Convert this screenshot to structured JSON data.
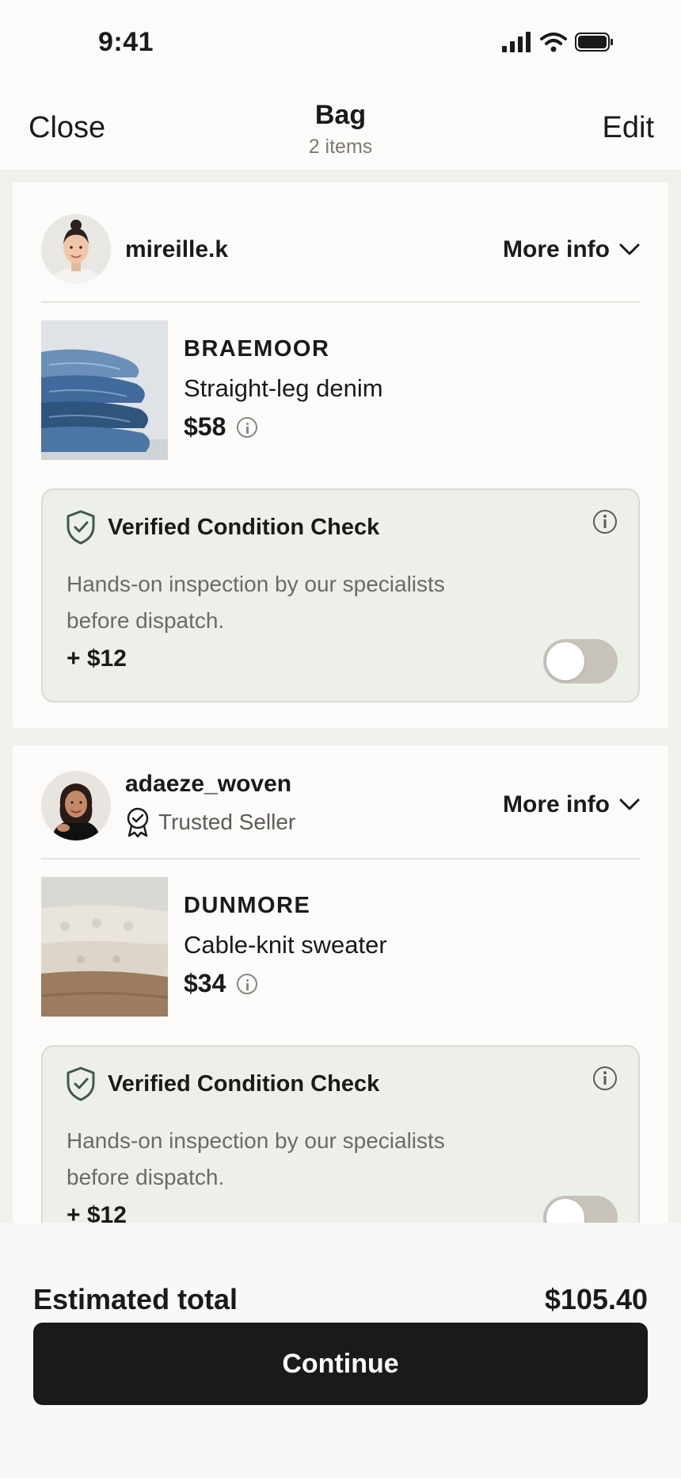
{
  "status_bar": {
    "time": "9:41"
  },
  "nav": {
    "close_label": "Close",
    "title": "Bag",
    "subtitle": "2 items",
    "edit_label": "Edit"
  },
  "sellers": [
    {
      "name": "mireille.k",
      "badge": "",
      "more_info_label": "More info",
      "item": {
        "brand": "BRAEMOOR",
        "name": "Straight-leg denim",
        "price": "$58"
      },
      "condition_check": {
        "title": "Verified Condition Check",
        "description": "Hands-on inspection by our specialists before dispatch.",
        "price": "+ $12",
        "enabled": false
      }
    },
    {
      "name": "adaeze_woven",
      "badge": "Trusted Seller",
      "more_info_label": "More info",
      "item": {
        "brand": "DUNMORE",
        "name": "Cable-knit sweater",
        "price": "$34"
      },
      "condition_check": {
        "title": "Verified Condition Check",
        "description": "Hands-on inspection by our specialists before dispatch.",
        "price": "+ $12",
        "enabled": false
      }
    }
  ],
  "footer": {
    "total_label": "Estimated total",
    "total_value": "$105.40",
    "continue_label": "Continue"
  },
  "colors": {
    "accent": "#1b1a18",
    "verified_bg": "#edf0e9",
    "verified_icon": "#3f5a4a",
    "toggle_off": "#c7c2ba"
  }
}
